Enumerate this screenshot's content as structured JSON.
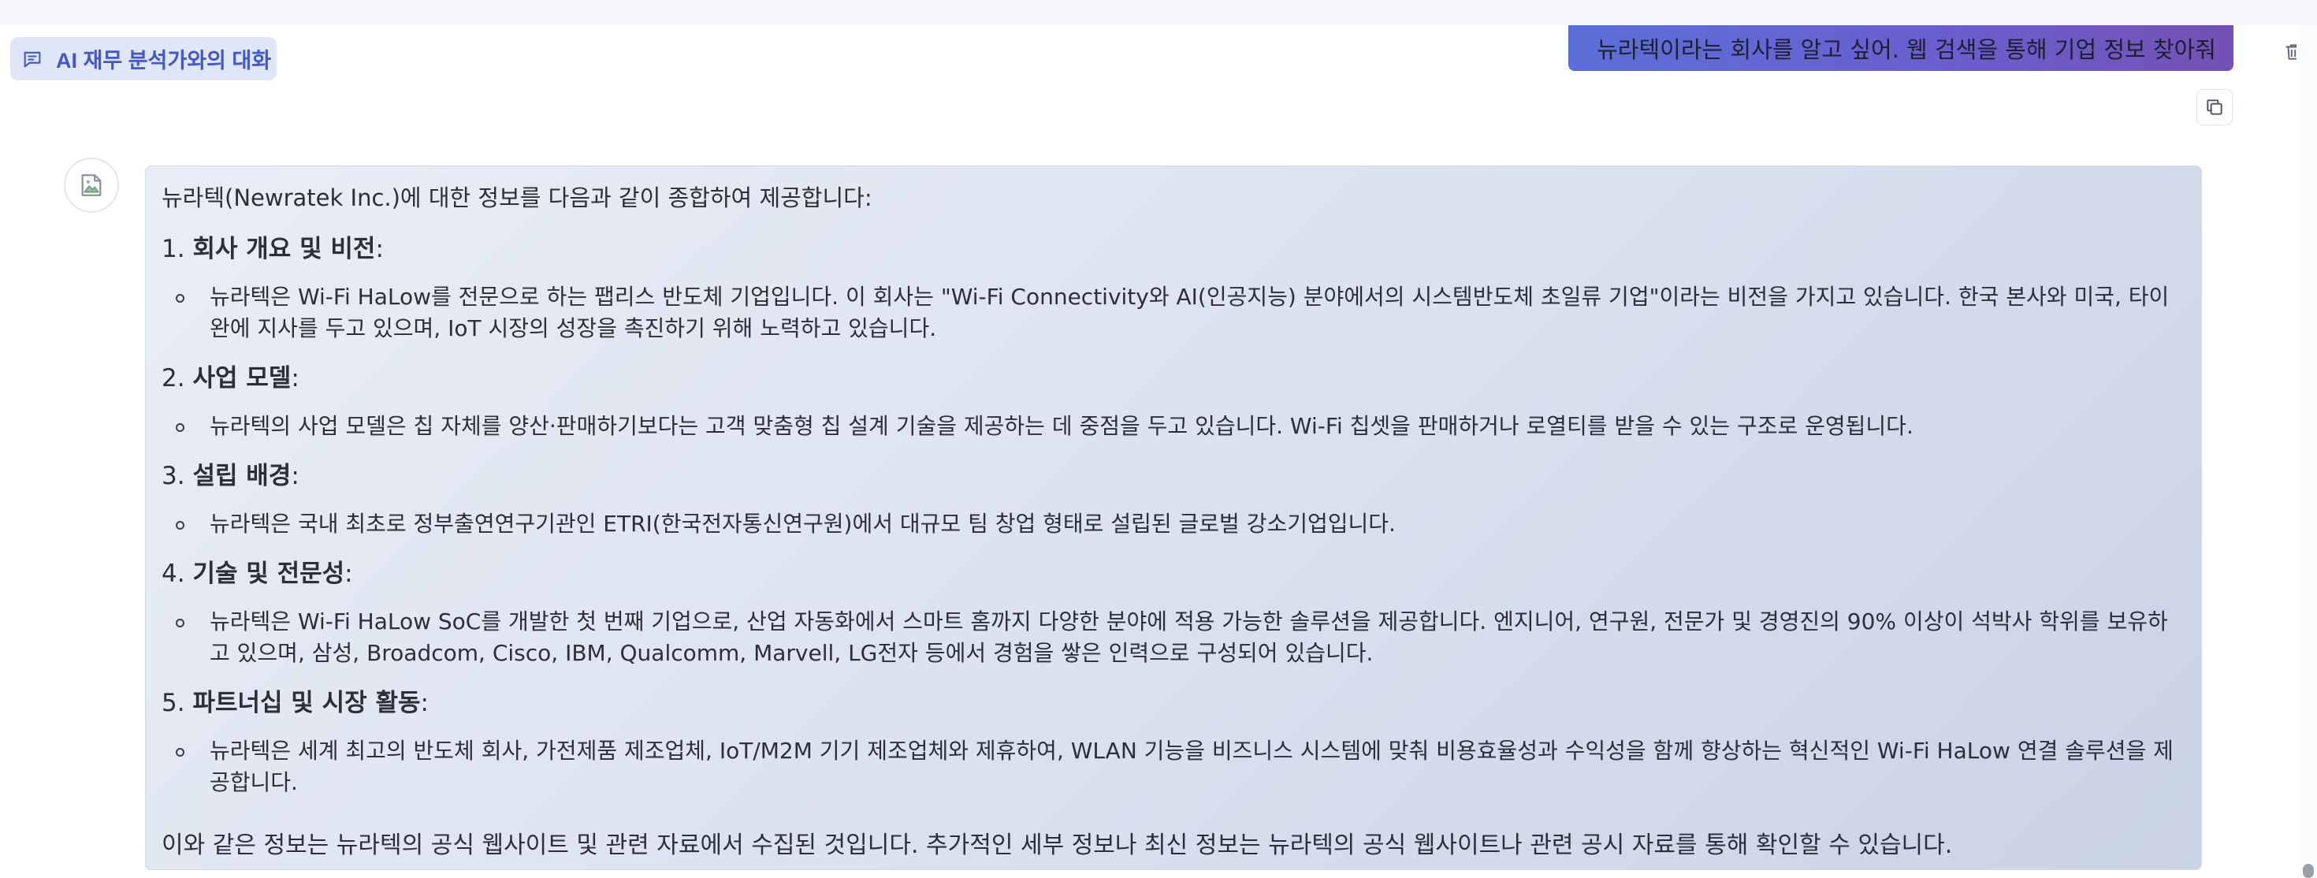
{
  "header": {
    "chat_title": "AI 재무 분석가와의 대화",
    "chat_icon": "chat-bubble-icon"
  },
  "user_message": {
    "text": "뉴라텍이라는 회사를 알고 싶어. 웹 검색을 통해 기업 정보 찾아줘"
  },
  "actions": {
    "delete_icon": "trash-icon",
    "copy_icon": "copy-icon"
  },
  "assistant": {
    "avatar_icon": "broken-image-icon",
    "intro": "뉴라텍(Newratek Inc.)에 대한 정보를 다음과 같이 종합하여 제공합니다:",
    "sections": [
      {
        "num": "1.",
        "title": "회사 개요 및 비전",
        "bullet": "뉴라텍은 Wi-Fi HaLow를 전문으로 하는 팹리스 반도체 기업입니다. 이 회사는 \"Wi-Fi Connectivity와 AI(인공지능) 분야에서의 시스템반도체 초일류 기업\"이라는 비전을 가지고 있습니다. 한국 본사와 미국, 타이완에 지사를 두고 있으며, IoT 시장의 성장을 촉진하기 위해 노력하고 있습니다."
      },
      {
        "num": "2.",
        "title": "사업 모델",
        "bullet": "뉴라텍의 사업 모델은 칩 자체를 양산·판매하기보다는 고객 맞춤형 칩 설계 기술을 제공하는 데 중점을 두고 있습니다. Wi-Fi 칩셋을 판매하거나 로열티를 받을 수 있는 구조로 운영됩니다."
      },
      {
        "num": "3.",
        "title": "설립 배경",
        "bullet": "뉴라텍은 국내 최초로 정부출연연구기관인 ETRI(한국전자통신연구원)에서 대규모 팀 창업 형태로 설립된 글로벌 강소기업입니다."
      },
      {
        "num": "4.",
        "title": "기술 및 전문성",
        "bullet": "뉴라텍은 Wi-Fi HaLow SoC를 개발한 첫 번째 기업으로, 산업 자동화에서 스마트 홈까지 다양한 분야에 적용 가능한 솔루션을 제공합니다. 엔지니어, 연구원, 전문가 및 경영진의 90% 이상이 석박사 학위를 보유하고 있으며, 삼성, Broadcom, Cisco, IBM, Qualcomm, Marvell, LG전자 등에서 경험을 쌓은 인력으로 구성되어 있습니다."
      },
      {
        "num": "5.",
        "title": "파트너십 및 시장 활동",
        "bullet": "뉴라텍은 세계 최고의 반도체 회사, 가전제품 제조업체, IoT/M2M 기기 제조업체와 제휴하여, WLAN 기능을 비즈니스 시스템에 맞춰 비용효율성과 수익성을 함께 향상하는 혁신적인 Wi-Fi HaLow 연결 솔루션을 제공합니다."
      }
    ],
    "outro": "이와 같은 정보는 뉴라텍의 공식 웹사이트 및 관련 자료에서 수집된 것입니다. 추가적인 세부 정보나 최신 정보는 뉴라텍의 공식 웹사이트나 관련 공시 자료를 통해 확인할 수 있습니다."
  },
  "colors": {
    "accent": "#4457c8",
    "user_bubble_start": "#5b6fd8",
    "user_bubble_end": "#7451b4",
    "answer_bg": "#dbe2ef"
  }
}
